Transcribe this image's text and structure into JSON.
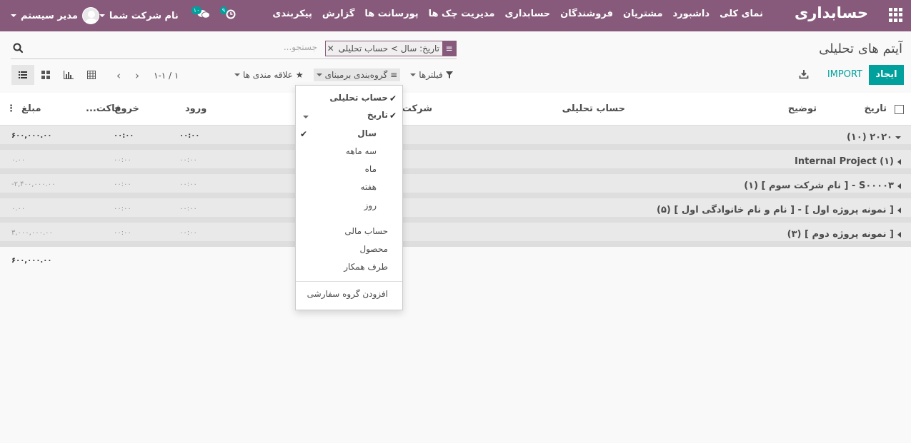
{
  "navbar": {
    "brand": "حسابداری",
    "menu": [
      "نمای کلی",
      "داشبورد",
      "مشتریان",
      "فروشندگان",
      "حسابداری",
      "مدیریت چک ها",
      "پورسانت ها",
      "گزارش",
      "پیکربندی"
    ],
    "user": "مدیر سیستم",
    "company": "نام شرکت شما",
    "chat_badge": "۱۰",
    "activity_badge": "۹"
  },
  "control_panel": {
    "title": "آیتم های تحلیلی",
    "facet_values": "تاریخ: سال > حساب تحلیلی",
    "search_placeholder": "جستجو...",
    "create_label": "ایجاد",
    "import_label": "IMPORT",
    "filters_label": "فیلترها",
    "groupby_label": "گروه‌بندی برمبنای",
    "favorites_label": "علاقه مندی ها",
    "pager_value": "۱-۱ / ۱"
  },
  "table": {
    "headers": {
      "date": "تاریخ",
      "description": "توضیح",
      "analytic_account": "حساب تحلیلی",
      "company": "شرکت",
      "debit": "ورود",
      "credit": "خروج",
      "invoice": "فاکت...",
      "amount": "مبلغ"
    },
    "groups": [
      {
        "label": "۲۰۲۰ (۱۰)",
        "debit": "۰۰:۰۰",
        "credit": "۰۰:۰۰",
        "amount": "۶۰۰,۰۰۰.۰۰",
        "top": true
      },
      {
        "label": "Internal Project (۱)",
        "debit": "۰۰:۰۰",
        "credit": "۰۰:۰۰",
        "amount": "۰.۰۰"
      },
      {
        "label": "S۰۰۰۰۳ - [ نام شرکت سوم ] (۱)",
        "debit": "۰۰:۰۰",
        "credit": "۰۰:۰۰",
        "amount": "۲,۴۰۰,۰۰۰.۰۰-"
      },
      {
        "label": "[ نمونه پروژه اول ] - [ نام و نام خانوادگی اول ] (۵)",
        "debit": "۰۰:۰۰",
        "credit": "۰۰:۰۰",
        "amount": "۰.۰۰"
      },
      {
        "label": "[ نمونه پروژه دوم ] (۳)",
        "debit": "۰۰:۰۰",
        "credit": "۰۰:۰۰",
        "amount": "۳,۰۰۰,۰۰۰.۰۰"
      }
    ],
    "footer_total": "۶۰۰,۰۰۰.۰۰"
  },
  "groupby_dropdown": {
    "analytic_account": "حساب تحلیلی",
    "date": "تاریخ",
    "year": "سال",
    "quarter": "سه ماهه",
    "month": "ماه",
    "week": "هفته",
    "day": "روز",
    "financial_account": "حساب مالی",
    "product": "محصول",
    "partner": "طرف همکار",
    "add_custom": "افزودن گروه سفارشی"
  },
  "colors": {
    "navbar": "#875a7b",
    "primary": "#00a09d"
  }
}
